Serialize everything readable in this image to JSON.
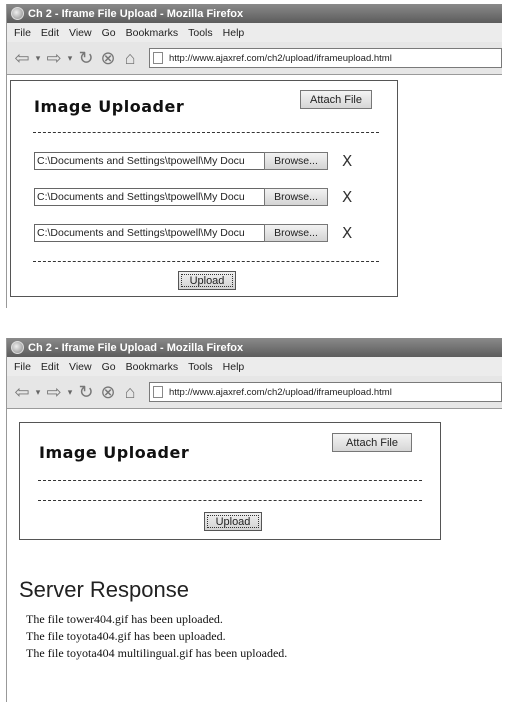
{
  "window": {
    "title": "Ch 2 - Iframe File Upload - Mozilla Firefox",
    "menu": [
      "File",
      "Edit",
      "View",
      "Go",
      "Bookmarks",
      "Tools",
      "Help"
    ],
    "url": "http://www.ajaxref.com/ch2/upload/iframeupload.html"
  },
  "uploader": {
    "heading": "Image Uploader",
    "attach_label": "Attach File",
    "upload_label": "Upload",
    "browse_label": "Browse...",
    "remove_label": "X",
    "file_rows": [
      {
        "value": "C:\\Documents and Settings\\tpowell\\My Docu"
      },
      {
        "value": "C:\\Documents and Settings\\tpowell\\My Docu"
      },
      {
        "value": "C:\\Documents and Settings\\tpowell\\My Docu"
      }
    ]
  },
  "server": {
    "heading": "Server Response",
    "lines": [
      "The file tower404.gif has been uploaded.",
      "The file toyota404.gif has been uploaded.",
      "The file toyota404 multilingual.gif has been uploaded."
    ]
  },
  "icons": {
    "back": "back-arrow-icon",
    "forward": "forward-arrow-icon",
    "reload": "reload-icon",
    "stop": "stop-icon",
    "home": "home-icon",
    "page": "page-icon",
    "firefox": "firefox-icon"
  }
}
